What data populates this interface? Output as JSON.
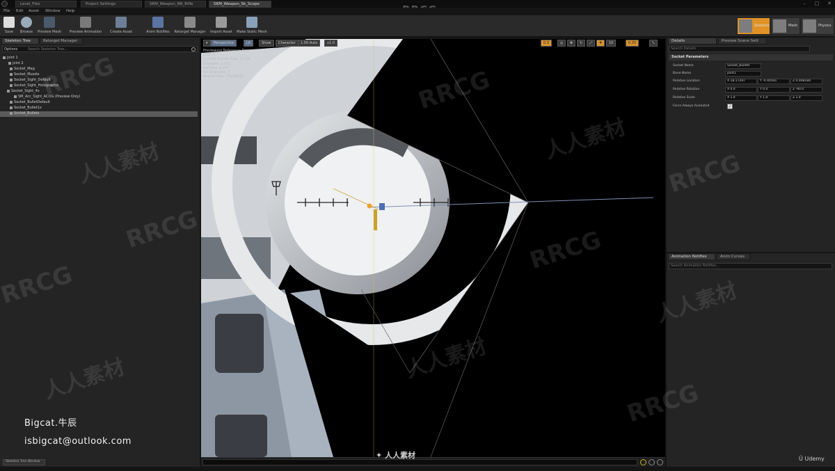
{
  "title_bar": {
    "tabs": [
      "Level_Flex",
      "Project Settings",
      "SKM_Weapon_NR_Rifle",
      "SKM_Weapon_Sk_Scope"
    ],
    "watermark": "RRCG"
  },
  "menu": [
    "File",
    "Edit",
    "Asset",
    "Window",
    "Help"
  ],
  "toolbar": {
    "buttons": [
      "Save",
      "Browse",
      "Preview Mesh",
      "Preview Animation",
      "Create Asset",
      "Anim Notifies",
      "Retarget Manager",
      "Import Asset",
      "Make Static Mesh"
    ],
    "modes": [
      "Skeleton",
      "Mesh",
      "Physics"
    ]
  },
  "skeleton_tree": {
    "tabs": [
      "Skeleton Tree",
      "Retarget Manager"
    ],
    "options_label": "Options",
    "search_placeholder": "Search Skeleton Tree...",
    "items": [
      "joint 1",
      "joint 2",
      "Socket_Mag",
      "Socket_Muzzle",
      "Socket_Sight_Default",
      "Socket_Sight_Holographic",
      "Socket_Sight_4x",
      "SM_Acc_Sight_ACOG (Preview Only)",
      "Socket_BulletDefault",
      "Socket_Bullet1x",
      "Socket_Bullets"
    ],
    "bottom_button": "Skeleton Tree Window"
  },
  "author": {
    "name": "Bigcat.牛辰",
    "email": "isbigcat@outlook.com"
  },
  "viewport": {
    "toolbar": [
      "Perspective",
      "Lit",
      "Show",
      "Character",
      "1.00 Auto",
      "x1.0"
    ],
    "right_toolbar": [
      "0.3",
      "10",
      "0.25"
    ],
    "info": [
      "Previewing Reference Pose",
      "LOD: 0",
      "Current Screen Size: 12.38",
      "Triangles: 2,151",
      "Vertices: 6,337",
      "UV Channels: 3",
      "Approx Size: 75x18x33"
    ]
  },
  "details": {
    "tabs": [
      "Details",
      "Preview Scene Sett"
    ],
    "search_placeholder": "Search Details",
    "category": "Socket Parameters",
    "socket_name_label": "Socket Name",
    "socket_name": "Socket_Bullets",
    "bone_name_label": "Bone Name",
    "bone_name": "joint1",
    "location_label": "Relative Location",
    "location": [
      "X 18.17297",
      "Y -0.40501",
      "Z 0.008184"
    ],
    "rotation_label": "Relative Rotation",
    "rotation": [
      "X 0.0",
      "Y 0.0",
      "Z -90.0"
    ],
    "scale_label": "Relative Scale",
    "scale": [
      "X 1.0",
      "Y 1.0",
      "Z 1.0"
    ],
    "force_label": "Force Always Animated",
    "force_value": "✓"
  },
  "anim_panel": {
    "tabs": [
      "Animation Notifies",
      "Anim Curves"
    ],
    "search_placeholder": "Search Animation Notifies..."
  },
  "footer": {
    "center_logo": "人人素材",
    "udemy": "Udemy"
  },
  "watermarks": [
    "RRCG",
    "人人素材"
  ]
}
